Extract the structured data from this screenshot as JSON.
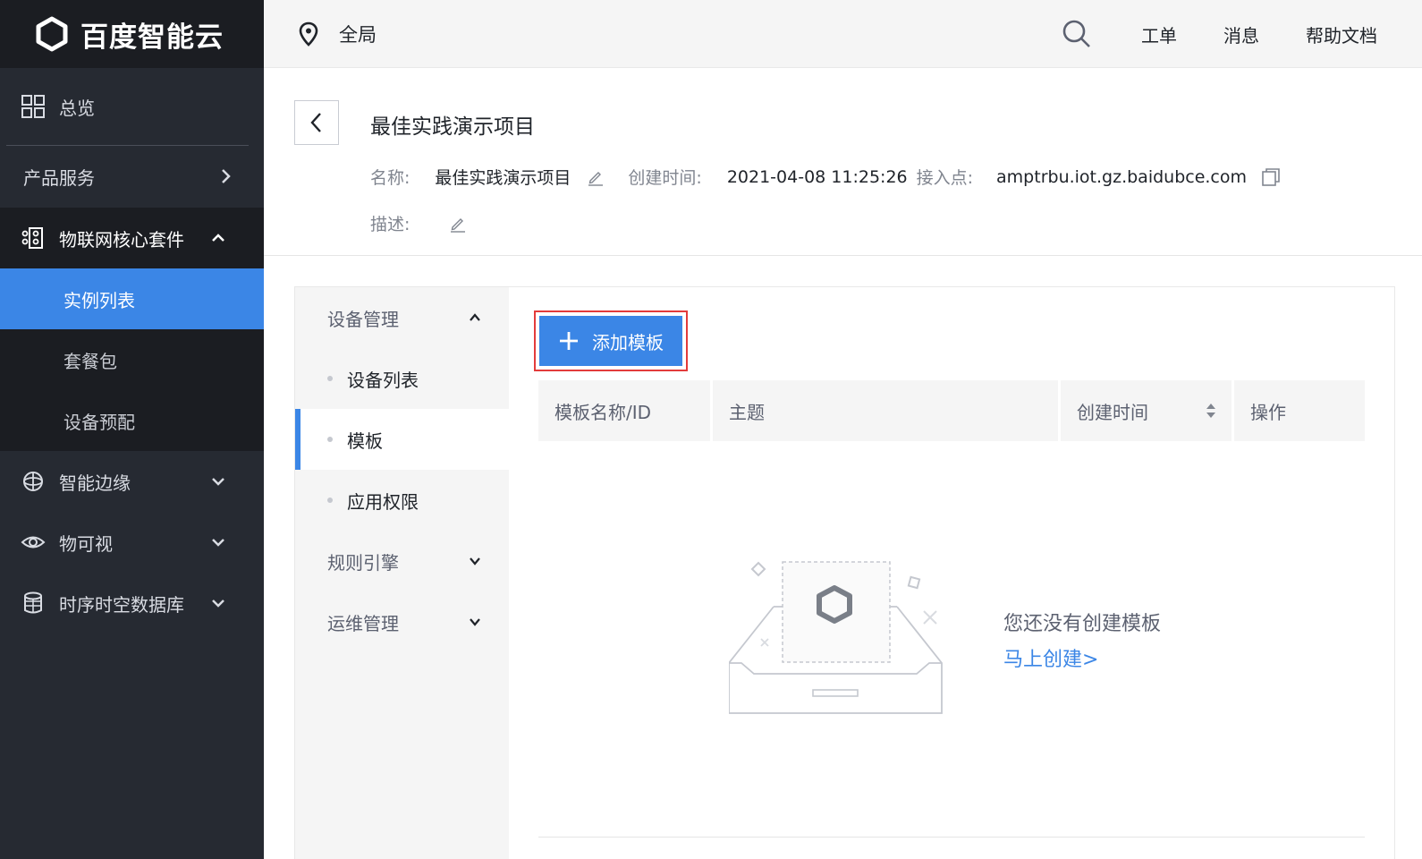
{
  "brand": {
    "name": "百度智能云"
  },
  "sidebar": {
    "overview": "总览",
    "products": "产品服务",
    "core_suite": "物联网核心套件",
    "sub_items": [
      "实例列表",
      "套餐包",
      "设备预配"
    ],
    "edge": "智能边缘",
    "visual": "物可视",
    "tsdb": "时序时空数据库"
  },
  "header": {
    "region": "全局",
    "links": [
      "工单",
      "消息",
      "帮助文档"
    ]
  },
  "project": {
    "title": "最佳实践演示项目",
    "name_label": "名称:",
    "name_value": "最佳实践演示项目",
    "created_label": "创建时间:",
    "created_value": "2021-04-08 11:25:26",
    "endpoint_label": "接入点:",
    "endpoint_value": "amptrbu.iot.gz.baidubce.com",
    "desc_label": "描述:"
  },
  "subnav": {
    "device_mgmt": "设备管理",
    "device_list": "设备列表",
    "template": "模板",
    "app_permission": "应用权限",
    "rule_engine": "规则引擎",
    "ops_mgmt": "运维管理"
  },
  "toolbar": {
    "add_template": "添加模板"
  },
  "table": {
    "columns": [
      "模板名称/ID",
      "主题",
      "创建时间",
      "操作"
    ]
  },
  "empty": {
    "message": "您还没有创建模板",
    "link": "马上创建>"
  },
  "colors": {
    "accent": "#3b86e6",
    "sidebar_bg": "#262a32",
    "sidebar_dark": "#1b1d22",
    "highlight_border": "#e33b3b"
  }
}
